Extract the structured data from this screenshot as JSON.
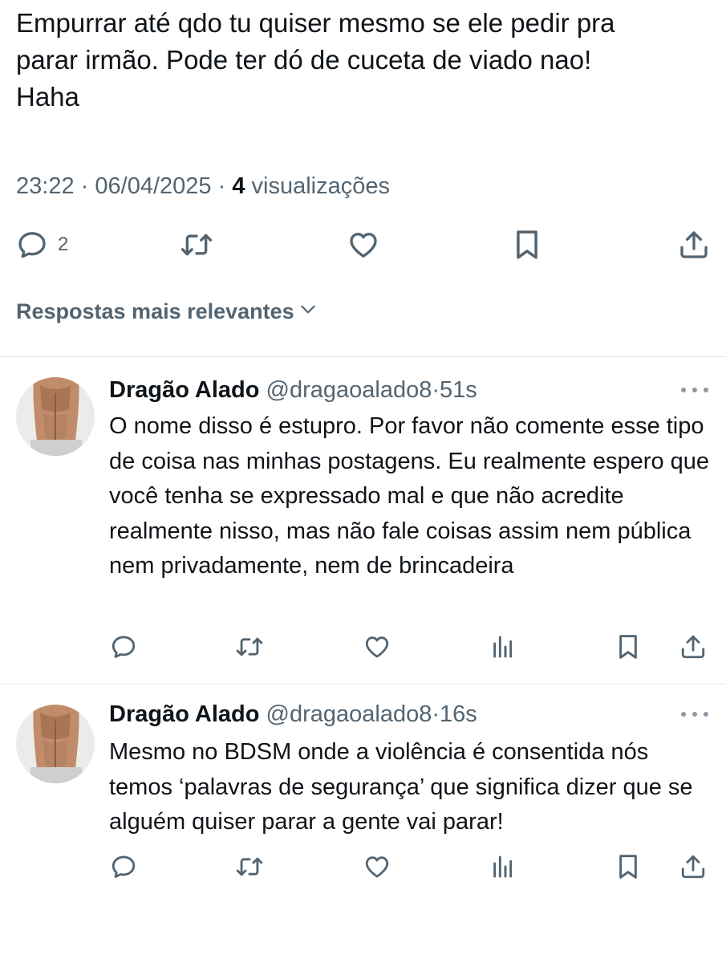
{
  "post": {
    "text": "Empurrar até qdo tu quiser mesmo se ele pedir pra\nparar irmão. Pode ter dó de cuceta de viado nao!\nHaha",
    "time": "23:22",
    "separator": "·",
    "date": "06/04/2025",
    "views_count": "4",
    "views_label": "visualizações",
    "reply_count": "2",
    "icons": {
      "reply": "reply-icon",
      "repost": "repost-icon",
      "like": "like-icon",
      "bookmark": "bookmark-icon",
      "share": "share-icon"
    }
  },
  "sort": {
    "label": "Respostas mais relevantes",
    "icon": "chevron-down-icon"
  },
  "replies": [
    {
      "name": "Dragão Alado",
      "handle": "@dragaoalado8",
      "separator": "·",
      "time": "51s",
      "text": "O nome disso é estupro. Por favor não comente esse tipo de coisa nas minhas postagens. Eu realmente espero que você tenha se expressado mal e que não acredite realmente nisso, mas não fale coisas assim nem pública nem privadamente, nem de brincadeira"
    },
    {
      "name": "Dragão Alado",
      "handle": "@dragaoalado8",
      "separator": "·",
      "time": "16s",
      "text": "Mesmo no BDSM onde a violência é consentida nós temos ‘palavras de segurança’ que significa dizer que se alguém quiser parar a gente vai parar!"
    }
  ],
  "colors": {
    "text": "#0f1419",
    "secondary": "#536471",
    "divider": "#e4e7ea",
    "background": "#ffffff"
  }
}
